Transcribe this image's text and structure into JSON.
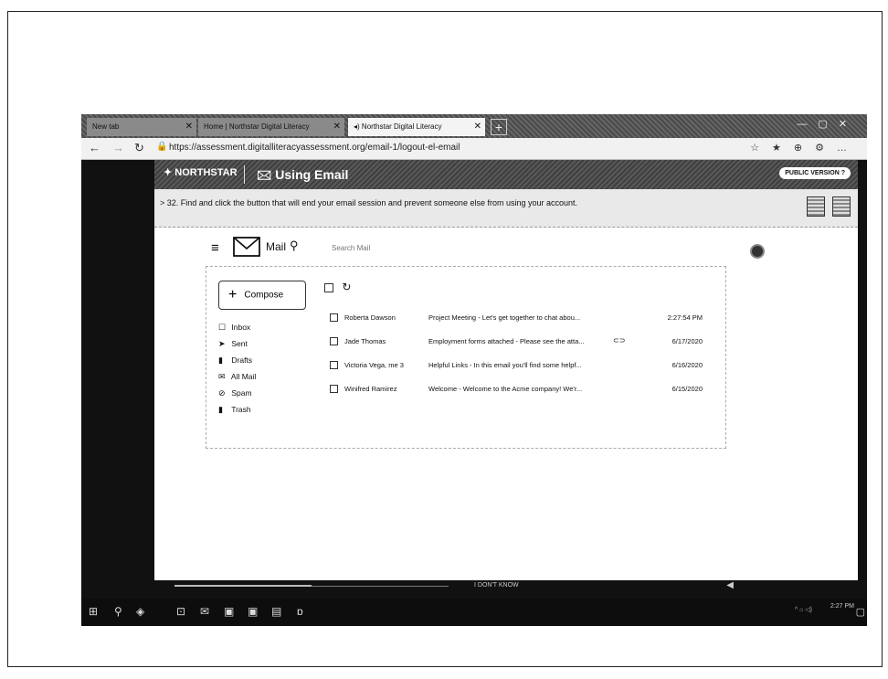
{
  "browser": {
    "tabs": [
      {
        "label": "New tab"
      },
      {
        "label": "Home | Northstar Digital Literacy"
      },
      {
        "label": "Northstar Digital Literacy"
      }
    ],
    "url": "https://assessment.digitalliteracyassessment.org/email-1/logout-el-email"
  },
  "northstar": {
    "logo": "NORTHSTAR",
    "module_title": "Using Email",
    "public_version": "PUBLIC VERSION"
  },
  "question": {
    "text": "> 32. Find and click the button that will end your email session and prevent someone else from using your account."
  },
  "mail": {
    "title": "Mail",
    "search_placeholder": "Search Mail",
    "compose_label": "Compose",
    "folders": [
      {
        "label": "Inbox",
        "icon": "inbox-icon"
      },
      {
        "label": "Sent",
        "icon": "sent-icon"
      },
      {
        "label": "Drafts",
        "icon": "drafts-icon"
      },
      {
        "label": "All Mail",
        "icon": "all-mail-icon"
      },
      {
        "label": "Spam",
        "icon": "spam-icon"
      },
      {
        "label": "Trash",
        "icon": "trash-icon"
      }
    ],
    "emails": [
      {
        "sender": "Roberta Dawson",
        "subject": "Project Meeting - Let's get together to chat abou...",
        "date": "2:27:54 PM"
      },
      {
        "sender": "Jade Thomas",
        "subject": "Employment forms attached - Please see the atta...",
        "date": "6/17/2020",
        "attachment": true
      },
      {
        "sender": "Victoria Vega, me 3",
        "subject": "Helpful Links - In this email you'll find some helpf...",
        "date": "6/16/2020"
      },
      {
        "sender": "Winifred Ramirez",
        "subject": "Welcome - Welcome to the Acme company! We'r...",
        "date": "6/15/2020"
      }
    ]
  },
  "footer": {
    "dont_know": "I DON'T KNOW",
    "progress": 0.5
  },
  "taskbar": {
    "time": "2:27 PM"
  }
}
